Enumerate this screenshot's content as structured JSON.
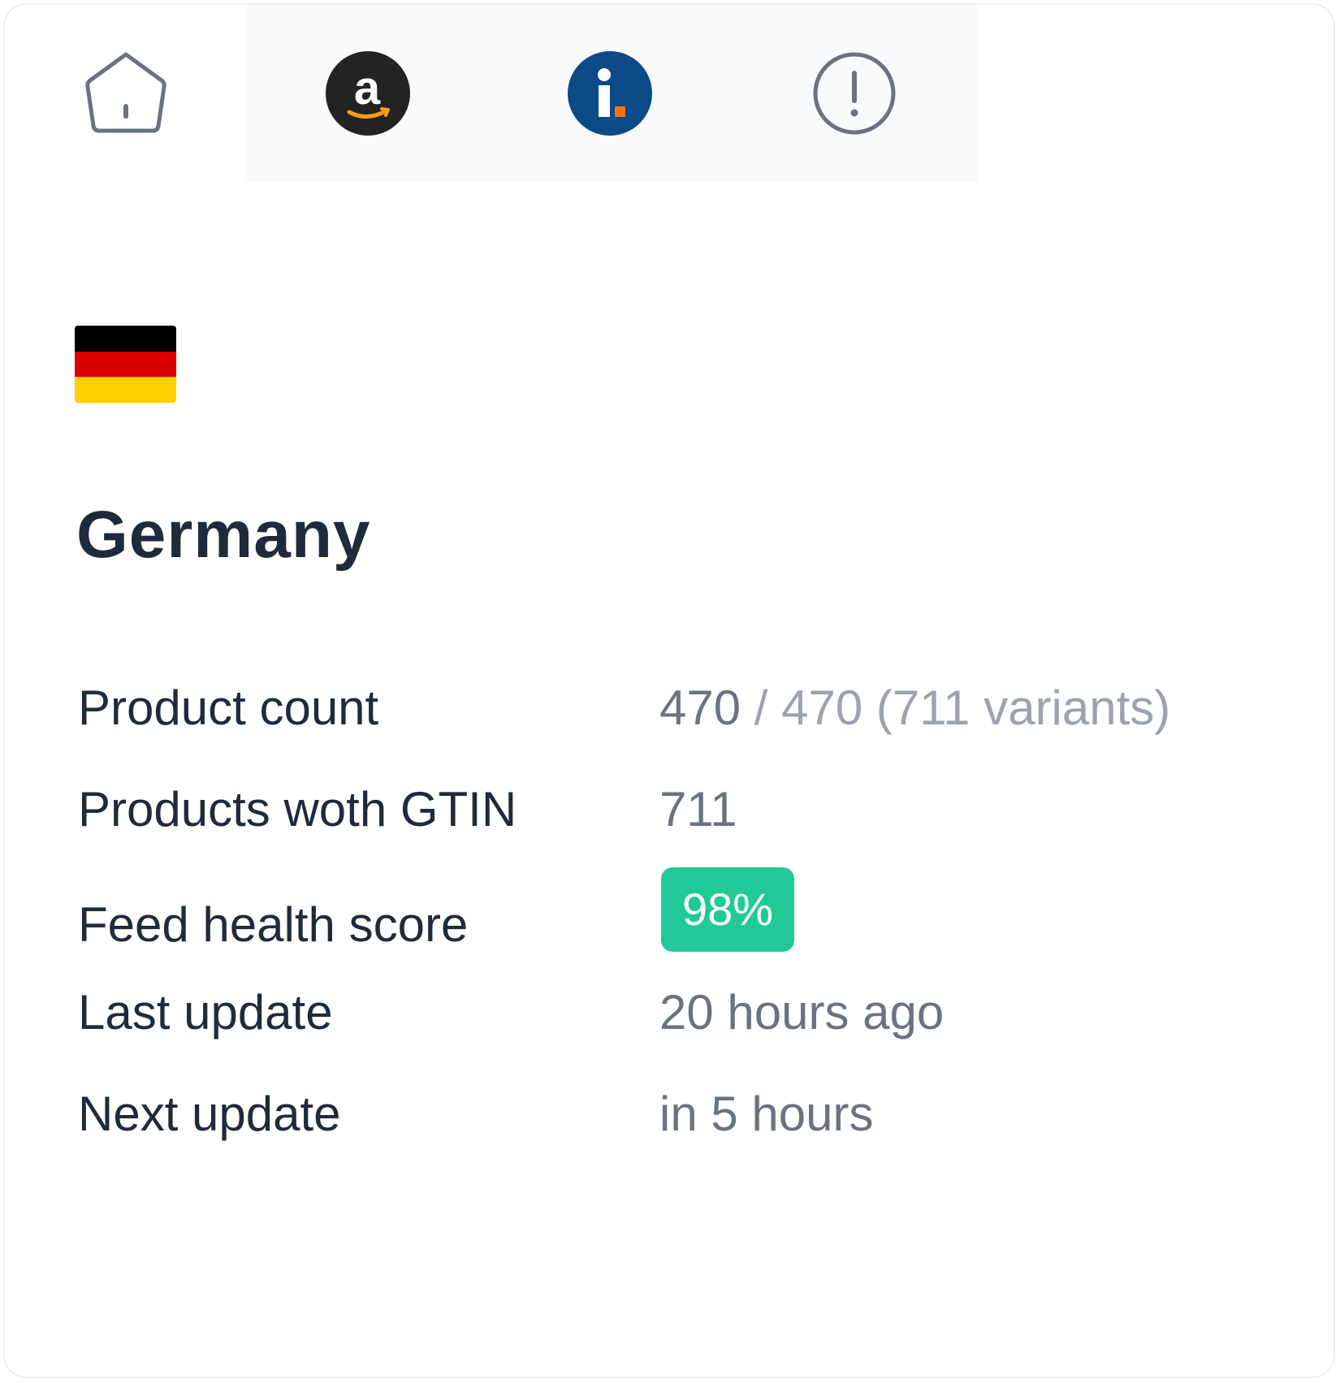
{
  "tabs": [
    {
      "name": "Home",
      "icon": "home-icon"
    },
    {
      "name": "Amazon",
      "icon": "amazon-icon"
    },
    {
      "name": "Idealo",
      "icon": "idealo-icon"
    },
    {
      "name": "Alerts",
      "icon": "alert-icon"
    }
  ],
  "country": {
    "name": "Germany",
    "flag_colors": [
      "#000000",
      "#dd0000",
      "#ffce00"
    ]
  },
  "stats": {
    "product_count": {
      "label": "Product count",
      "value_main": "470",
      "value_rest": " / 470 (711 variants)"
    },
    "products_with_gtin": {
      "label": "Products woth GTIN",
      "value": "711"
    },
    "feed_health": {
      "label": "Feed health score",
      "value": "98%",
      "color": "#20c997"
    },
    "last_update": {
      "label": "Last update",
      "value": "20 hours ago"
    },
    "next_update": {
      "label": "Next update",
      "value": "in 5 hours"
    }
  }
}
